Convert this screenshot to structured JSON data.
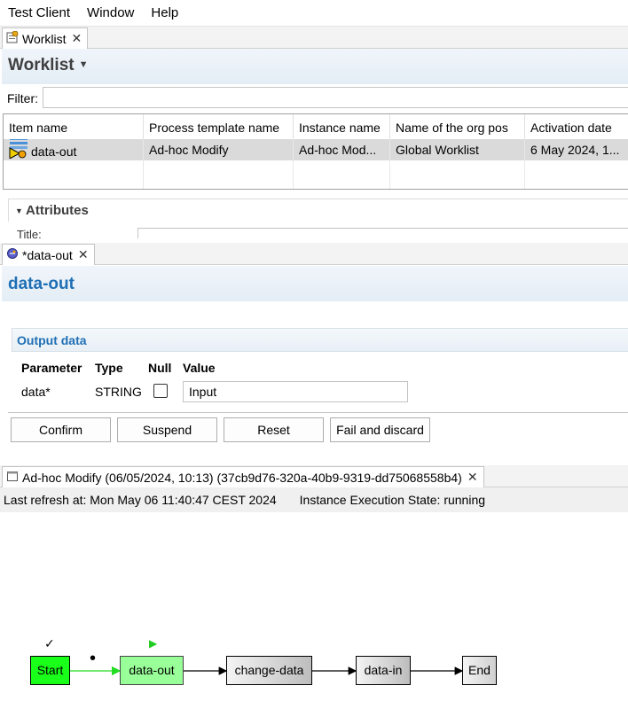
{
  "menu": {
    "items": [
      "Test Client",
      "Window",
      "Help"
    ]
  },
  "worklist": {
    "tab_label": "Worklist",
    "title": "Worklist",
    "filter_label": "Filter:",
    "filter_value": "",
    "columns": [
      "Item name",
      "Process template name",
      "Instance name",
      "Name of the org pos",
      "Activation date"
    ],
    "rows": [
      {
        "item_name": "data-out",
        "template": "Ad-hoc Modify",
        "instance": "Ad-hoc Mod...",
        "org_pos": "Global Worklist",
        "activation": "6 May 2024, 1..."
      }
    ],
    "attributes_label": "Attributes",
    "attr_title_label": "Title:"
  },
  "data_out": {
    "tab_label": "*data-out",
    "title": "data-out",
    "section_label": "Output data",
    "headers": {
      "parameter": "Parameter",
      "type": "Type",
      "null": "Null",
      "value": "Value"
    },
    "param": {
      "name": "data*",
      "type": "STRING",
      "null_checked": false,
      "value": "Input"
    },
    "buttons": {
      "confirm": "Confirm",
      "suspend": "Suspend",
      "reset": "Reset",
      "fail": "Fail and discard"
    }
  },
  "process": {
    "tab_label": "Ad-hoc Modify (06/05/2024, 10:13) (37cb9d76-320a-40b9-9319-dd75068558b4)",
    "last_refresh": "Last refresh at: Mon May 06 11:40:47 CEST 2024",
    "state": "Instance Execution State: running",
    "nodes": [
      {
        "label": "Start",
        "status": "completed"
      },
      {
        "label": "data-out",
        "status": "active"
      },
      {
        "label": "change-data",
        "status": "pending"
      },
      {
        "label": "data-in",
        "status": "pending"
      },
      {
        "label": "End",
        "status": "pending"
      }
    ],
    "markers": {
      "done": "✓",
      "current": "▶",
      "token": "•"
    }
  },
  "colors": {
    "header_gradient": "#e4edf5",
    "title_blue": "#1f6fb5",
    "node_start": "#1aff1a",
    "node_active": "#99ff99",
    "edge_active": "#22dd22"
  }
}
